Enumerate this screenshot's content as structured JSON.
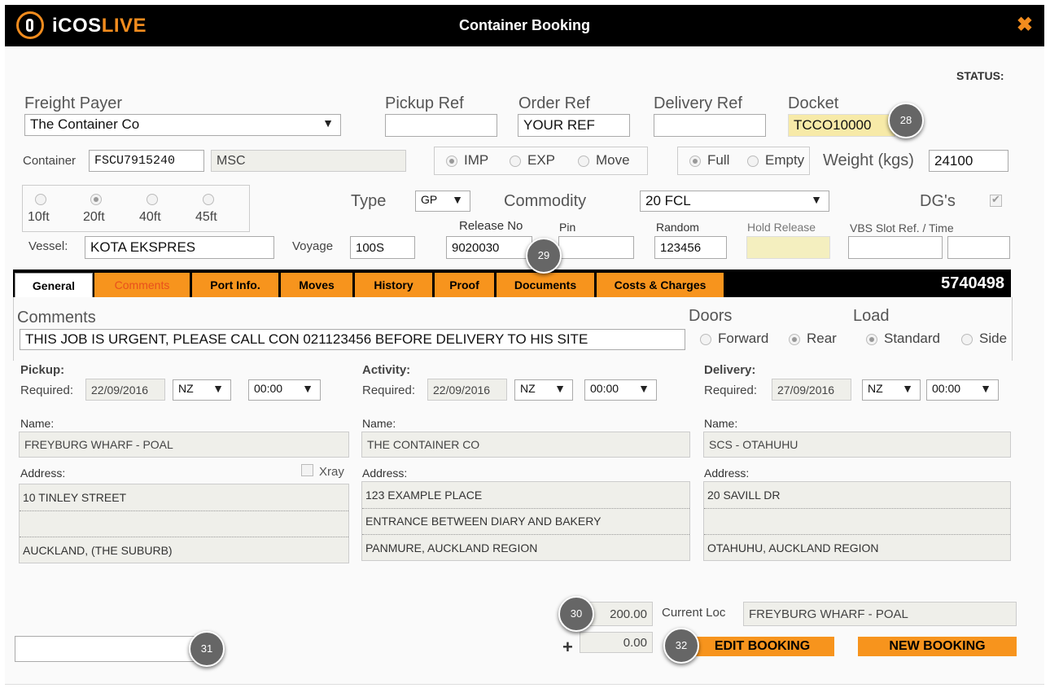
{
  "window": {
    "brand_i": "iCOS",
    "brand_live": "LIVE",
    "title": "Container Booking",
    "close_glyph": "✖"
  },
  "header": {
    "status_label": "STATUS:",
    "freight_payer_label": "Freight Payer",
    "freight_payer_value": "The Container Co",
    "pickup_ref_label": "Pickup Ref",
    "pickup_ref_value": "",
    "order_ref_label": "Order Ref",
    "order_ref_value": "YOUR REF",
    "delivery_ref_label": "Delivery Ref",
    "delivery_ref_value": "",
    "docket_label": "Docket",
    "docket_value": "TCCO10000",
    "container_label": "Container",
    "container_value": "FSCU7915240",
    "line_value": "MSC",
    "direction_options": [
      "IMP",
      "EXP",
      "Move"
    ],
    "direction_selected": "IMP",
    "load_options": [
      "Full",
      "Empty"
    ],
    "load_selected": "Full",
    "weight_label": "Weight (kgs)",
    "weight_value": "24100",
    "size_options": [
      "10ft",
      "20ft",
      "40ft",
      "45ft"
    ],
    "size_selected": "20ft",
    "type_label": "Type",
    "type_value": "GP",
    "commodity_label": "Commodity",
    "commodity_value": "20 FCL",
    "dgs_label": "DG's",
    "dgs_checked": true,
    "vessel_label": "Vessel:",
    "vessel_value": "KOTA EKSPRES",
    "voyage_label": "Voyage",
    "voyage_value": "100S",
    "release_no_label": "Release No",
    "release_no_value": "9020030",
    "pin_label": "Pin",
    "pin_value": "",
    "random_label": "Random",
    "random_value": "123456",
    "hold_release_label": "Hold Release",
    "hold_release_value": "",
    "vbs_label": "VBS Slot Ref. / Time",
    "vbs_ref_value": "",
    "vbs_time_value": ""
  },
  "tabs": [
    {
      "label": "General"
    },
    {
      "label": "Comments"
    },
    {
      "label": "Port Info."
    },
    {
      "label": "Moves"
    },
    {
      "label": "History"
    },
    {
      "label": "Proof"
    },
    {
      "label": "Documents"
    },
    {
      "label": "Costs & Charges"
    }
  ],
  "job_number": "5740498",
  "general": {
    "comments_label": "Comments",
    "comments_value": "THIS JOB IS URGENT, PLEASE CALL CON 021123456 BEFORE DELIVERY TO HIS SITE",
    "doors_label": "Doors",
    "doors_options": [
      "Forward",
      "Rear"
    ],
    "doors_selected": "Rear",
    "load_label": "Load",
    "load_options": [
      "Standard",
      "Side"
    ],
    "load_selected": "Standard",
    "required_label": "Required:",
    "name_label": "Name:",
    "address_label": "Address:",
    "xray_label": "Xray",
    "pickup": {
      "heading": "Pickup:",
      "date": "22/09/2016",
      "tz": "NZ",
      "time": "00:00",
      "name": "FREYBURG WHARF - POAL",
      "address": [
        "10 TINLEY STREET",
        "",
        "AUCKLAND,    (THE SUBURB)"
      ]
    },
    "activity": {
      "heading": "Activity:",
      "date": "22/09/2016",
      "tz": "NZ",
      "time": "00:00",
      "name": "THE CONTAINER CO",
      "address": [
        "123 EXAMPLE PLACE",
        "ENTRANCE BETWEEN DIARY AND BAKERY",
        "PANMURE,    AUCKLAND REGION"
      ]
    },
    "delivery": {
      "heading": "Delivery:",
      "date": "27/09/2016",
      "tz": "NZ",
      "time": "00:00",
      "name": "SCS - OTAHUHU",
      "address": [
        "20 SAVILL DR",
        "",
        "OTAHUHU, AUCKLAND REGION"
      ]
    }
  },
  "footer": {
    "amount_1": "200.00",
    "amount_2": "0.00",
    "plus": "+",
    "current_loc_label": "Current Loc",
    "current_loc_value": "FREYBURG WHARF - POAL",
    "edit_button": "EDIT BOOKING",
    "new_button": "NEW BOOKING",
    "bottom_input_value": ""
  },
  "callouts": [
    "28",
    "29",
    "30",
    "31",
    "32"
  ],
  "colors": {
    "accent": "#f7941d",
    "tab_bar": "#000000",
    "docket_bg": "#f7eaa8"
  }
}
